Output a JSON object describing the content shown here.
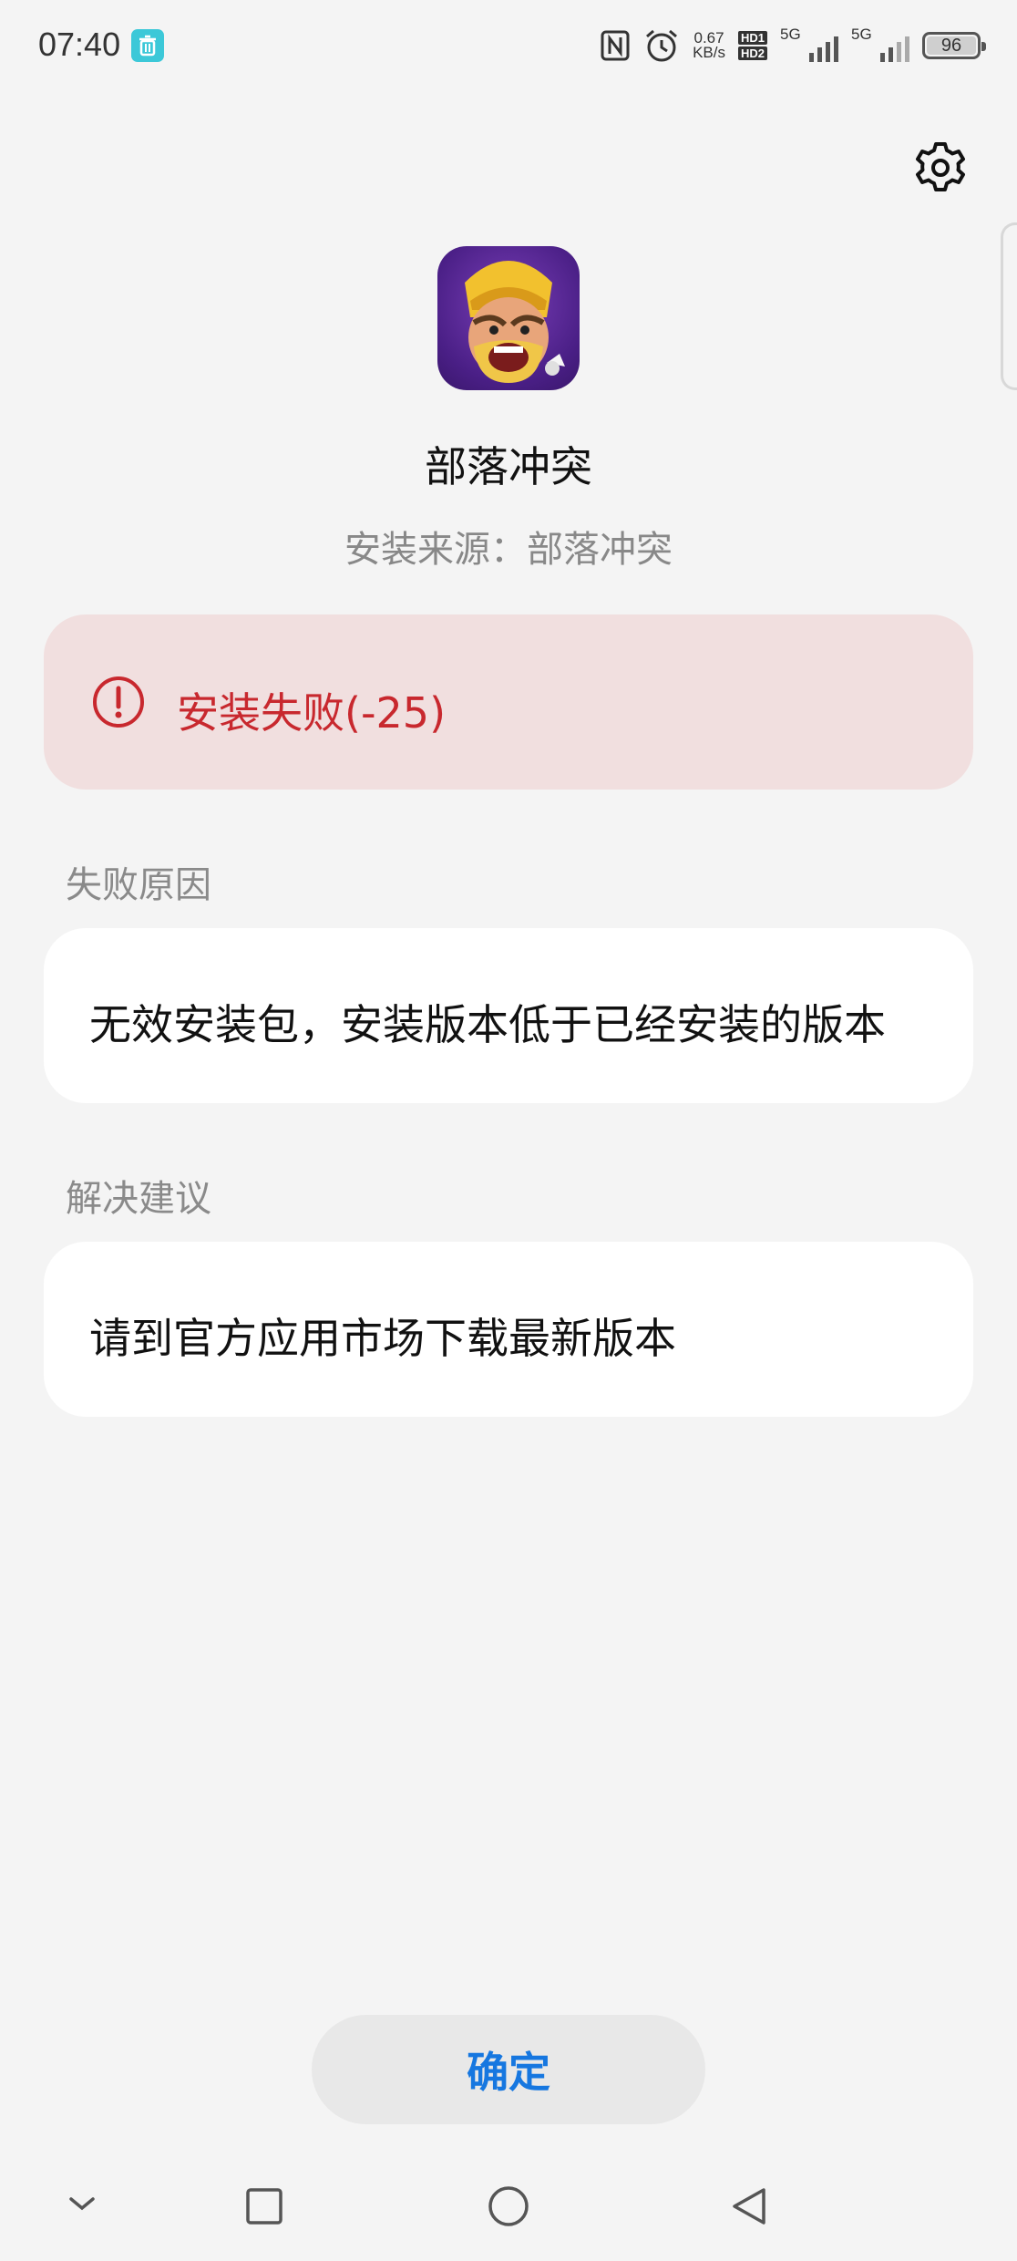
{
  "status_bar": {
    "time": "07:40",
    "network_speed_value": "0.67",
    "network_speed_unit": "KB/s",
    "hd1": "HD1",
    "hd2": "HD2",
    "sim1": "5G",
    "sim2": "5G",
    "battery": "96",
    "icons": [
      "trash-icon",
      "nfc-icon",
      "alarm-icon",
      "signal-icon",
      "battery-icon"
    ]
  },
  "app": {
    "name": "部落冲突",
    "source": "安装来源：部落冲突"
  },
  "error": {
    "message": "安装失败(-25)",
    "color": "#c8282e"
  },
  "failure": {
    "label": "失败原因",
    "text": "无效安装包，安装版本低于已经安装的版本"
  },
  "suggestion": {
    "label": "解决建议",
    "text": "请到官方应用市场下载最新版本"
  },
  "confirm_label": "确定",
  "accent_color": "#1677e0"
}
